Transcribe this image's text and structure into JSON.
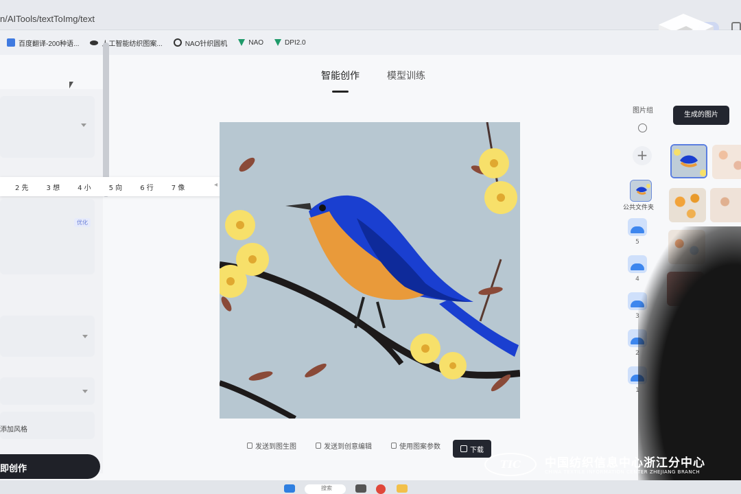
{
  "browser": {
    "url": "n/AITools/textToImg/text",
    "bookmarks": [
      {
        "label": "百度翻译-200种语...",
        "icon": "translate-icon"
      },
      {
        "label": "人工智能纺织图案...",
        "icon": "ai-icon"
      },
      {
        "label": "NAO针织圆机",
        "icon": "c-logo-icon"
      },
      {
        "label": "NAO",
        "icon": "v-logo-icon"
      },
      {
        "label": "DPI2.0",
        "icon": "v-logo-icon"
      }
    ]
  },
  "header": {
    "tabs": [
      {
        "label": "智能创作",
        "active": true
      },
      {
        "label": "模型训练",
        "active": false
      }
    ]
  },
  "left_panel": {
    "prompt_strip": [
      "2 先",
      "3 想",
      "4 小",
      "5 向",
      "6 行",
      "7 像"
    ],
    "optimize_label": "优化",
    "add_style_label": "添加风格",
    "create_button": "即创作"
  },
  "canvas": {
    "subject": "bird-on-branch-image"
  },
  "actions": {
    "send_to_img2img": "发送到图生图",
    "send_to_editor": "发送到创意编辑",
    "use_params": "使用图案参数",
    "download": "下载"
  },
  "right_panel": {
    "group_label": "图片组",
    "public_folder_label": "公共文件夹",
    "groups": [
      "5",
      "4",
      "3",
      "2",
      "1"
    ],
    "generated_button": "生成的图片"
  },
  "watermark": {
    "logo_text": "TIC",
    "cn": "中国纺织信息中心浙江分中心",
    "en": "CHINA TEXTILE INFORMATION CENTER ZHEJIANG BRANCH"
  },
  "taskbar": {
    "search_placeholder": "搜索"
  },
  "colors": {
    "accent_dark": "#23262f",
    "selection_blue": "#5a7ee0",
    "bird_blue": "#1a3fd0",
    "bird_orange": "#e99a3a",
    "flower_yellow": "#f7df5a"
  }
}
